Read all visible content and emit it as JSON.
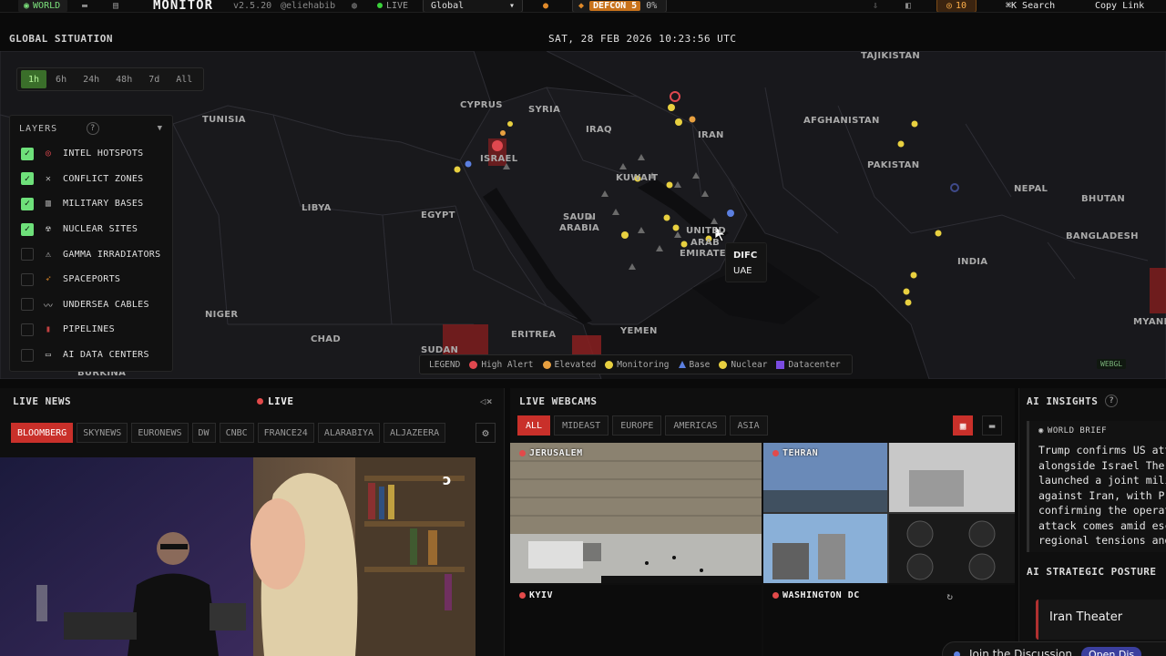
{
  "topbar": {
    "world_tab": "WORLD",
    "brand": "MONITOR",
    "version": "v2.5.20",
    "handle": "@eliehabib",
    "live": "LIVE",
    "region_select": "Global",
    "defcon_label": "DEFCON 5",
    "defcon_pct": "0%",
    "alert_count": "10",
    "search_shortcut": "⌘K",
    "search_label": "Search",
    "copy_link": "Copy Link"
  },
  "map": {
    "title": "GLOBAL SITUATION",
    "clock": "SAT, 28 FEB 2026 10:23:56 UTC",
    "time_filters": [
      "1h",
      "6h",
      "24h",
      "48h",
      "7d",
      "All"
    ],
    "active_filter": "1h",
    "layers_title": "LAYERS",
    "layers": [
      {
        "label": "INTEL HOTSPOTS",
        "checked": true,
        "icon": "🎯"
      },
      {
        "label": "CONFLICT ZONES",
        "checked": true,
        "icon": "⚔"
      },
      {
        "label": "MILITARY BASES",
        "checked": true,
        "icon": "🏛"
      },
      {
        "label": "NUCLEAR SITES",
        "checked": true,
        "icon": "☢"
      },
      {
        "label": "GAMMA IRRADIATORS",
        "checked": false,
        "icon": "⚠"
      },
      {
        "label": "SPACEPORTS",
        "checked": false,
        "icon": "🚀"
      },
      {
        "label": "UNDERSEA CABLES",
        "checked": false,
        "icon": "〰"
      },
      {
        "label": "PIPELINES",
        "checked": false,
        "icon": "▮"
      },
      {
        "label": "AI DATA CENTERS",
        "checked": false,
        "icon": "▭"
      }
    ],
    "countries": {
      "tajikistan": "TAJIKISTAN",
      "cyprus": "CYPRUS",
      "syria": "SYRIA",
      "tunisia": "TUNISIA",
      "iraq": "IRAQ",
      "iran": "IRAN",
      "afghanistan": "AFGHANISTAN",
      "israel": "ISRAEL",
      "pakistan": "PAKISTAN",
      "kuwait": "KUWAIT",
      "nepal": "NEPAL",
      "bhutan": "BHUTAN",
      "libya": "LIBYA",
      "egypt": "EGYPT",
      "saudi1": "SAUDI",
      "saudi2": "ARABIA",
      "uae1": "UNITED",
      "uae2": "ARAB",
      "uae3": "EMIRATES",
      "bangladesh": "BANGLADESH",
      "india": "INDIA",
      "niger": "NIGER",
      "chad": "CHAD",
      "yemen": "YEMEN",
      "eritrea": "ERITREA",
      "sudan": "SUDAN",
      "burkina": "BURKINA",
      "myanmar": "MYANM"
    },
    "tooltip": {
      "name": "DIFC",
      "country": "UAE"
    },
    "legend": {
      "title": "LEGEND",
      "items": [
        "High Alert",
        "Elevated",
        "Monitoring",
        "Base",
        "Nuclear",
        "Datacenter"
      ]
    },
    "webgl": "WEBGL",
    "colors": {
      "high_alert": "#e0484f",
      "elevated": "#e8a040",
      "monitoring": "#e8d040",
      "base": "#5b7fe0",
      "nuclear": "#e8d040",
      "datacenter": "#7a4be0"
    }
  },
  "news": {
    "title": "LIVE NEWS",
    "live": "LIVE",
    "channels": [
      "BLOOMBERG",
      "SKYNEWS",
      "EURONEWS",
      "DW",
      "CNBC",
      "FRANCE24",
      "ALARABIYA",
      "ALJAZEERA"
    ],
    "active_channel": "BLOOMBERG"
  },
  "webcams": {
    "title": "LIVE WEBCAMS",
    "tabs": [
      "ALL",
      "MIDEAST",
      "EUROPE",
      "AMERICAS",
      "ASIA"
    ],
    "active_tab": "ALL",
    "feeds": [
      "JERUSALEM",
      "TEHRAN",
      "KYIV",
      "WASHINGTON DC"
    ]
  },
  "ai": {
    "title": "AI INSIGHTS",
    "brief_tag": "WORLD BRIEF",
    "brief_lines": [
      "Trump confirms US atta",
      "alongside Israel The U",
      "launched a joint milit",
      "against Iran, with Pre",
      "confirming the operati",
      "attack comes amid esca",
      "regional tensions and"
    ],
    "posture_title": "AI STRATEGIC POSTURE",
    "theater": "Iran Theater"
  },
  "discussion": {
    "label": "Join the Discussion",
    "button": "Open Dis"
  }
}
